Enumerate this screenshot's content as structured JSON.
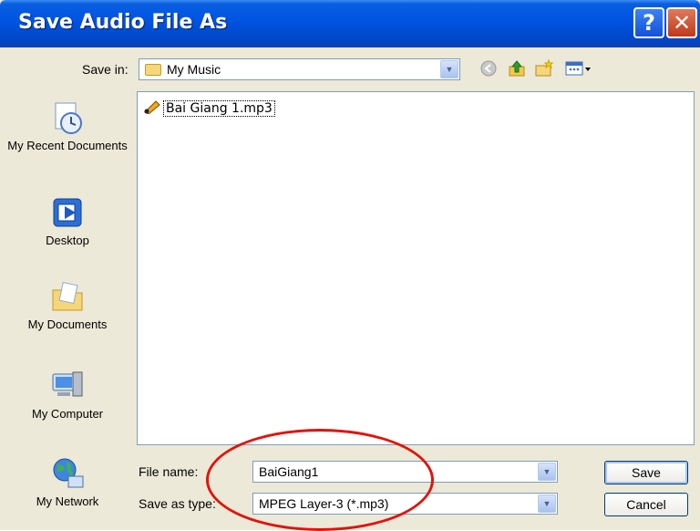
{
  "window": {
    "title": "Save Audio File As",
    "help_glyph": "?",
    "close_glyph": "✕"
  },
  "toolbar": {
    "save_in_label": "Save in:",
    "save_in_value": "My Music",
    "icons": [
      "back-icon",
      "up-folder-icon",
      "new-folder-icon",
      "view-menu-icon"
    ]
  },
  "places": [
    {
      "label": "My Recent Documents",
      "icon": "recent-documents-icon"
    },
    {
      "label": "Desktop",
      "icon": "desktop-icon"
    },
    {
      "label": "My Documents",
      "icon": "my-documents-icon"
    },
    {
      "label": "My Computer",
      "icon": "my-computer-icon"
    },
    {
      "label": "My Network",
      "icon": "my-network-icon"
    }
  ],
  "files": [
    {
      "name": "Bai Giang 1.mp3",
      "icon": "audio-file-icon"
    }
  ],
  "form": {
    "file_name_label": "File name:",
    "file_name_value": "BaiGiang1",
    "save_as_type_label": "Save as type:",
    "save_as_type_value": "MPEG Layer-3 (*.mp3)",
    "save_button": "Save",
    "cancel_button": "Cancel"
  },
  "colors": {
    "titlebar": "#0054e3",
    "highlight_ellipse": "#e3120b"
  }
}
